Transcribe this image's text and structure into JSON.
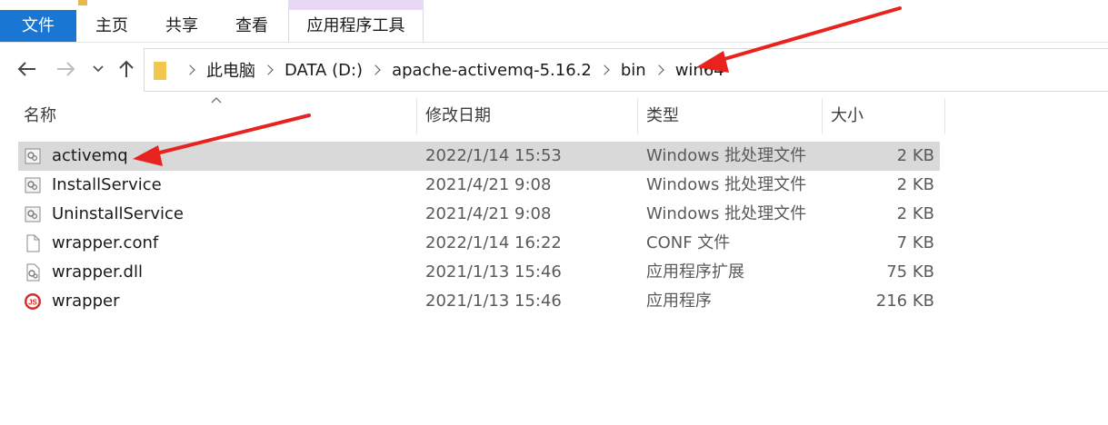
{
  "ribbon": {
    "tabs": [
      {
        "label": "文件"
      },
      {
        "label": "主页"
      },
      {
        "label": "共享"
      },
      {
        "label": "查看"
      },
      {
        "label": "应用程序工具"
      }
    ]
  },
  "nav": {
    "back_icon": "back-arrow-icon",
    "forward_icon": "forward-arrow-icon",
    "recent_icon": "chevron-down-icon",
    "up_icon": "up-arrow-icon"
  },
  "address": {
    "crumbs": [
      "此电脑",
      "DATA (D:)",
      "apache-activemq-5.16.2",
      "bin",
      "win64"
    ]
  },
  "columns": {
    "name": "名称",
    "date": "修改日期",
    "type": "类型",
    "size": "大小"
  },
  "files": [
    {
      "name": "activemq",
      "date": "2022/1/14 15:53",
      "type": "Windows 批处理文件",
      "size": "2 KB",
      "icon": "batch-file-icon",
      "selected": true
    },
    {
      "name": "InstallService",
      "date": "2021/4/21 9:08",
      "type": "Windows 批处理文件",
      "size": "2 KB",
      "icon": "batch-file-icon"
    },
    {
      "name": "UninstallService",
      "date": "2021/4/21 9:08",
      "type": "Windows 批处理文件",
      "size": "2 KB",
      "icon": "batch-file-icon"
    },
    {
      "name": "wrapper.conf",
      "date": "2022/1/14 16:22",
      "type": "CONF 文件",
      "size": "7 KB",
      "icon": "blank-file-icon"
    },
    {
      "name": "wrapper.dll",
      "date": "2021/1/13 15:46",
      "type": "应用程序扩展",
      "size": "75 KB",
      "icon": "dll-file-icon"
    },
    {
      "name": "wrapper",
      "date": "2021/1/13 15:46",
      "type": "应用程序",
      "size": "216 KB",
      "icon": "js-exe-icon"
    }
  ],
  "colors": {
    "file_tab": "#1976d2",
    "tool_header": "#e8d9f4",
    "selected_row": "#d9d9d9",
    "annotation_arrow": "#e8231f"
  }
}
